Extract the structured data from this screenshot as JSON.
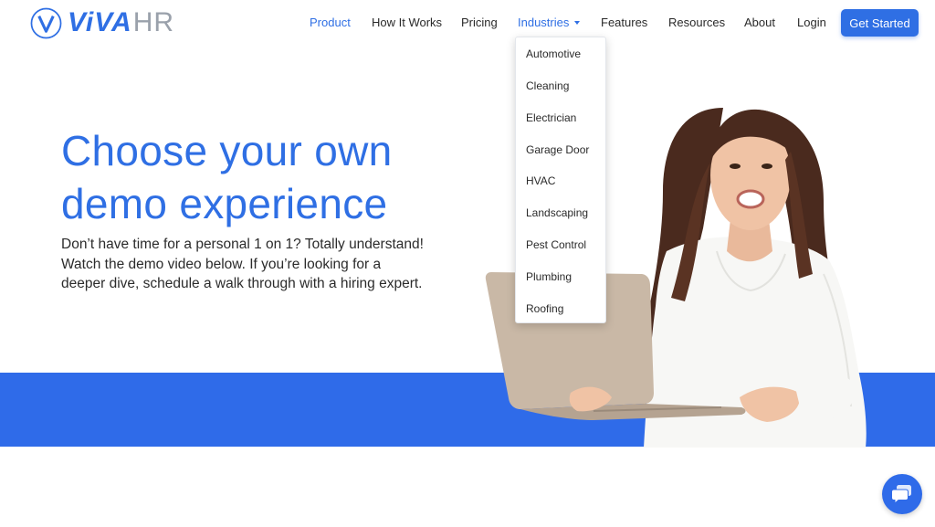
{
  "brand": {
    "name_primary": "ViVA",
    "name_secondary": "HR",
    "mark_letter": "V",
    "accent_color": "#2f6fe4"
  },
  "nav": {
    "items": [
      {
        "label": "Product",
        "active": true
      },
      {
        "label": "How It Works",
        "active": false
      },
      {
        "label": "Pricing",
        "active": false
      },
      {
        "label": "Industries",
        "active": true,
        "has_caret": true
      },
      {
        "label": "Features",
        "active": false
      },
      {
        "label": "Resources",
        "active": false
      },
      {
        "label": "About",
        "active": false
      },
      {
        "label": "Login",
        "active": false
      }
    ],
    "cta_label": "Get Started"
  },
  "industries_menu": {
    "items": [
      "Automotive",
      "Cleaning",
      "Electrician",
      "Garage Door",
      "HVAC",
      "Landscaping",
      "Pest Control",
      "Plumbing",
      "Roofing"
    ]
  },
  "hero": {
    "title_line1": "Choose your own",
    "title_line2": "demo experience",
    "body": "Don’t have time for a personal 1 on 1? Totally understand! Watch the demo video below.  If you’re looking for a deeper dive, schedule a walk through with a hiring expert."
  },
  "widgets": {
    "chat_icon": "chat-icon"
  }
}
